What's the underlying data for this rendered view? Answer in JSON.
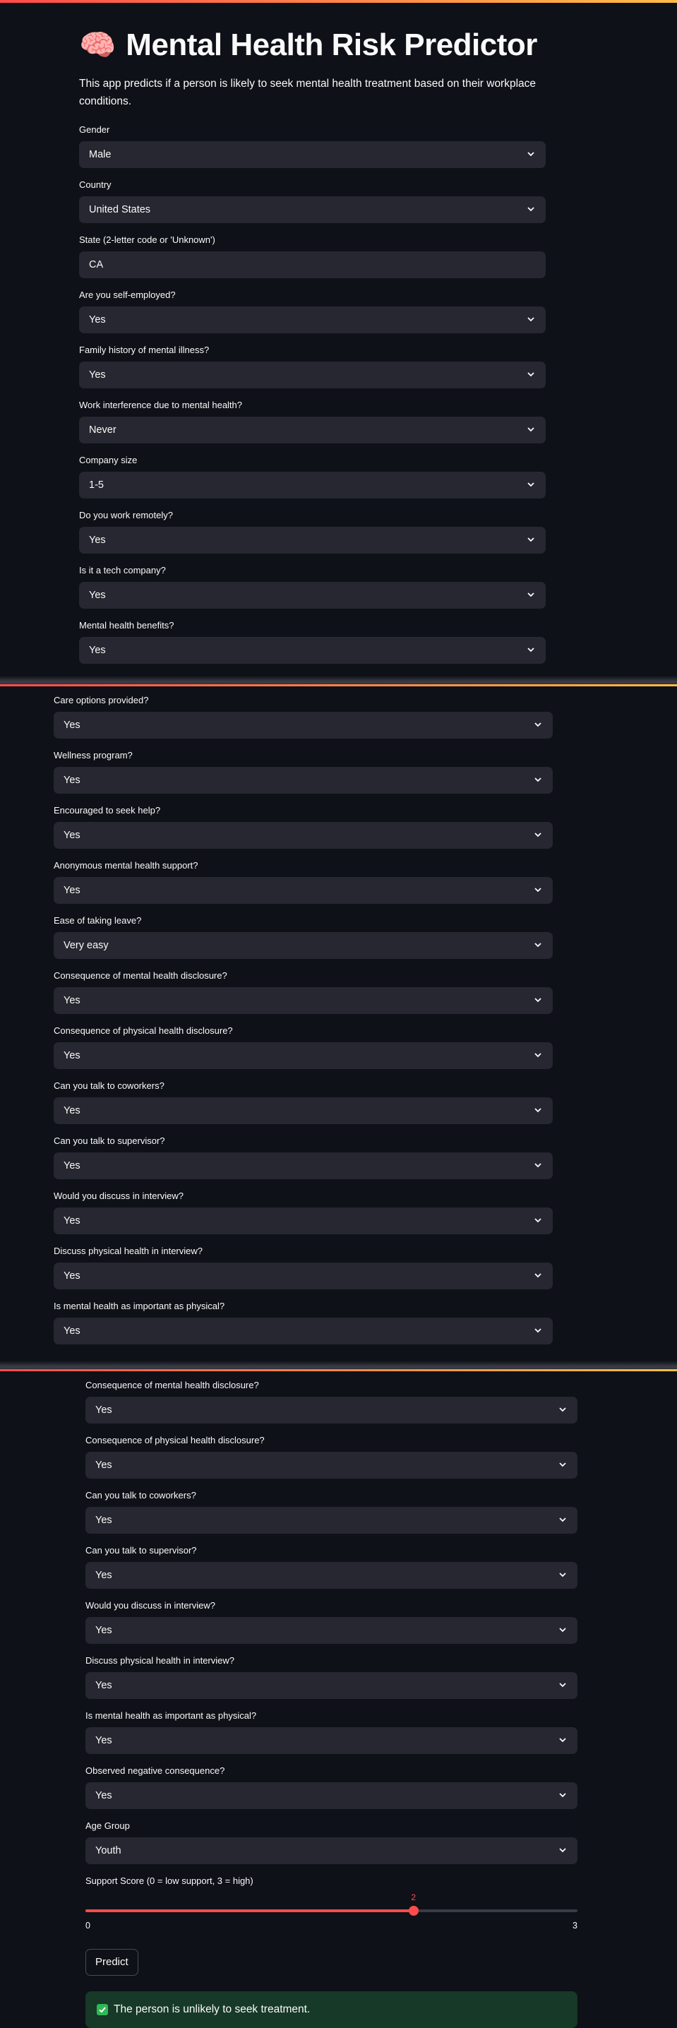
{
  "title": "Mental Health Risk Predictor",
  "title_emoji": "🧠",
  "description": "This app predicts if a person is likely to seek mental health treatment based on their workplace conditions.",
  "section1": [
    {
      "label": "Gender",
      "value": "Male",
      "type": "select"
    },
    {
      "label": "Country",
      "value": "United States",
      "type": "select"
    },
    {
      "label": "State (2-letter code or 'Unknown')",
      "value": "CA",
      "type": "text"
    },
    {
      "label": "Are you self-employed?",
      "value": "Yes",
      "type": "select"
    },
    {
      "label": "Family history of mental illness?",
      "value": "Yes",
      "type": "select"
    },
    {
      "label": "Work interference due to mental health?",
      "value": "Never",
      "type": "select"
    },
    {
      "label": "Company size",
      "value": "1-5",
      "type": "select"
    },
    {
      "label": "Do you work remotely?",
      "value": "Yes",
      "type": "select"
    },
    {
      "label": "Is it a tech company?",
      "value": "Yes",
      "type": "select"
    },
    {
      "label": "Mental health benefits?",
      "value": "Yes",
      "type": "select"
    }
  ],
  "section2": [
    {
      "label": "Care options provided?",
      "value": "Yes"
    },
    {
      "label": "Wellness program?",
      "value": "Yes"
    },
    {
      "label": "Encouraged to seek help?",
      "value": "Yes"
    },
    {
      "label": "Anonymous mental health support?",
      "value": "Yes"
    },
    {
      "label": "Ease of taking leave?",
      "value": "Very easy"
    },
    {
      "label": "Consequence of mental health disclosure?",
      "value": "Yes"
    },
    {
      "label": "Consequence of physical health disclosure?",
      "value": "Yes"
    },
    {
      "label": "Can you talk to coworkers?",
      "value": "Yes"
    },
    {
      "label": "Can you talk to supervisor?",
      "value": "Yes"
    },
    {
      "label": "Would you discuss in interview?",
      "value": "Yes"
    },
    {
      "label": "Discuss physical health in interview?",
      "value": "Yes"
    },
    {
      "label": "Is mental health as important as physical?",
      "value": "Yes"
    }
  ],
  "section3": [
    {
      "label": "Consequence of mental health disclosure?",
      "value": "Yes"
    },
    {
      "label": "Consequence of physical health disclosure?",
      "value": "Yes"
    },
    {
      "label": "Can you talk to coworkers?",
      "value": "Yes"
    },
    {
      "label": "Can you talk to supervisor?",
      "value": "Yes"
    },
    {
      "label": "Would you discuss in interview?",
      "value": "Yes"
    },
    {
      "label": "Discuss physical health in interview?",
      "value": "Yes"
    },
    {
      "label": "Is mental health as important as physical?",
      "value": "Yes"
    },
    {
      "label": "Observed negative consequence?",
      "value": "Yes"
    },
    {
      "label": "Age Group",
      "value": "Youth"
    }
  ],
  "slider": {
    "label": "Support Score (0 = low support, 3 = high)",
    "min": "0",
    "max": "3",
    "value": "2",
    "fraction": 0.6667
  },
  "predict_button": "Predict",
  "result": "The person is unlikely to seek treatment.",
  "colors": {
    "accent": "#ff4b4b",
    "background": "#0e1117",
    "input_bg": "#262730",
    "success_bg": "#173928"
  }
}
